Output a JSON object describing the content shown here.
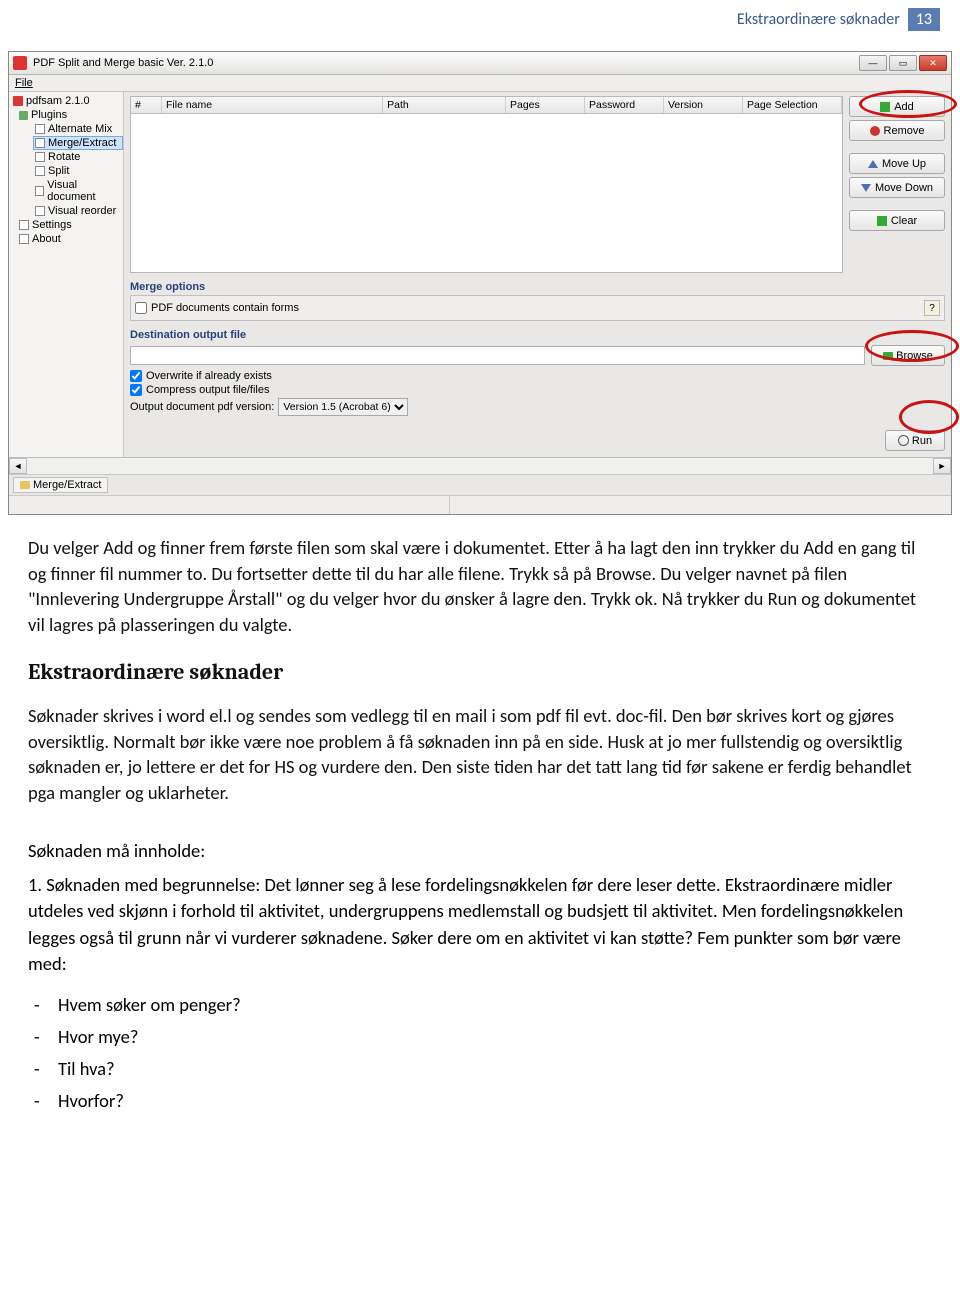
{
  "header": {
    "title": "Ekstraordinære søknader",
    "page": "13"
  },
  "app": {
    "title": "PDF Split and Merge basic Ver. 2.1.0",
    "menu_file": "File",
    "tree": {
      "root": "pdfsam 2.1.0",
      "plugins_label": "Plugins",
      "items": [
        "Alternate Mix",
        "Merge/Extract",
        "Rotate",
        "Split",
        "Visual document",
        "Visual reorder"
      ],
      "settings": "Settings",
      "about": "About"
    },
    "columns": {
      "num": "#",
      "file": "File name",
      "path": "Path",
      "pages": "Pages",
      "password": "Password",
      "version": "Version",
      "pagesel": "Page Selection"
    },
    "buttons": {
      "add": "Add",
      "remove": "Remove",
      "moveup": "Move Up",
      "movedown": "Move Down",
      "clear": "Clear"
    },
    "merge_label": "Merge options",
    "merge_chk": "PDF documents contain forms",
    "dest_label": "Destination output file",
    "browse": "Browse",
    "chk_overwrite": "Overwrite if already exists",
    "chk_compress": "Compress output file/files",
    "version_label": "Output document pdf version:",
    "version_value": "Version 1.5 (Acrobat 6)",
    "run": "Run",
    "tab": "Merge/Extract"
  },
  "para1": "Du velger Add og finner frem første filen som skal være i dokumentet. Etter å ha lagt den inn trykker du Add en gang til og finner fil nummer to. Du fortsetter dette til du har alle filene. Trykk så på Browse. Du velger navnet på filen \"Innlevering Undergruppe Årstall\" og du velger hvor du ønsker å lagre den. Trykk ok. Nå trykker du Run og dokumentet vil lagres på plasseringen du valgte.",
  "h2": "Ekstraordinære søknader",
  "para2": "Søknader skrives i word el.l og sendes som vedlegg til en mail i som pdf fil evt. doc-fil. Den bør skrives kort og gjøres oversiktlig. Normalt bør ikke være noe problem å få søknaden inn på en side. Husk at jo mer fullstendig og oversiktlig søknaden er, jo lettere er det for HS og vurdere den. Den siste tiden har det tatt lang tid før sakene er ferdig behandlet pga mangler og uklarheter.",
  "sub_heading": "Søknaden må innholde:",
  "num1": "1. Søknaden med begrunnelse: Det lønner seg å lese fordelingsnøkkelen før dere leser dette. Ekstraordinære midler utdeles ved skjønn i forhold til aktivitet, undergruppens medlemstall og budsjett til aktivitet. Men fordelingsnøkkelen legges også til grunn når vi vurderer søknadene. Søker dere om en aktivitet vi kan støtte? Fem punkter som bør være med:",
  "bullets": [
    "Hvem søker om penger?",
    "Hvor mye?",
    "Til hva?",
    "Hvorfor?"
  ]
}
